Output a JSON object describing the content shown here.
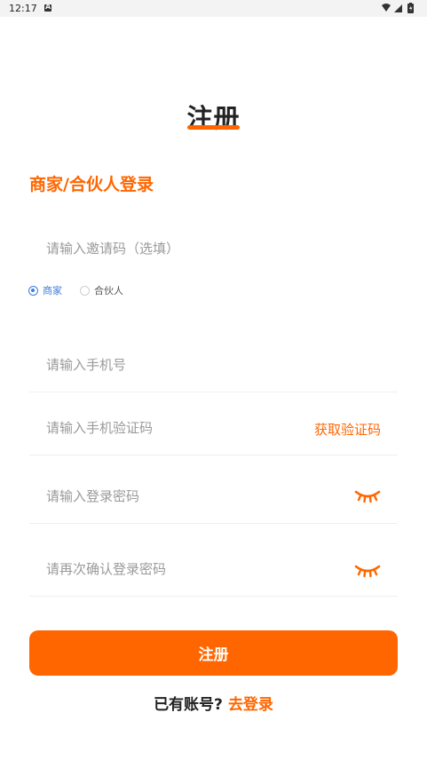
{
  "status_bar": {
    "time": "12:17"
  },
  "page": {
    "title": "注册",
    "section_heading": "商家/合伙人登录"
  },
  "invite": {
    "placeholder": "请输入邀请码（选填）"
  },
  "role_options": {
    "merchant_label": "商家",
    "partner_label": "合伙人",
    "selected": "商家"
  },
  "form": {
    "phone_placeholder": "请输入手机号",
    "code_placeholder": "请输入手机验证码",
    "get_code_label": "获取验证码",
    "password_placeholder": "请输入登录密码",
    "confirm_placeholder": "请再次确认登录密码"
  },
  "actions": {
    "register_label": "注册",
    "login_prompt": "已有账号?",
    "login_link": "去登录"
  },
  "colors": {
    "accent": "#ff6600",
    "radio_selected": "#3b7de0",
    "placeholder": "#9a9a9a"
  },
  "icons": {
    "password_toggle": "eye-closed-icon"
  }
}
